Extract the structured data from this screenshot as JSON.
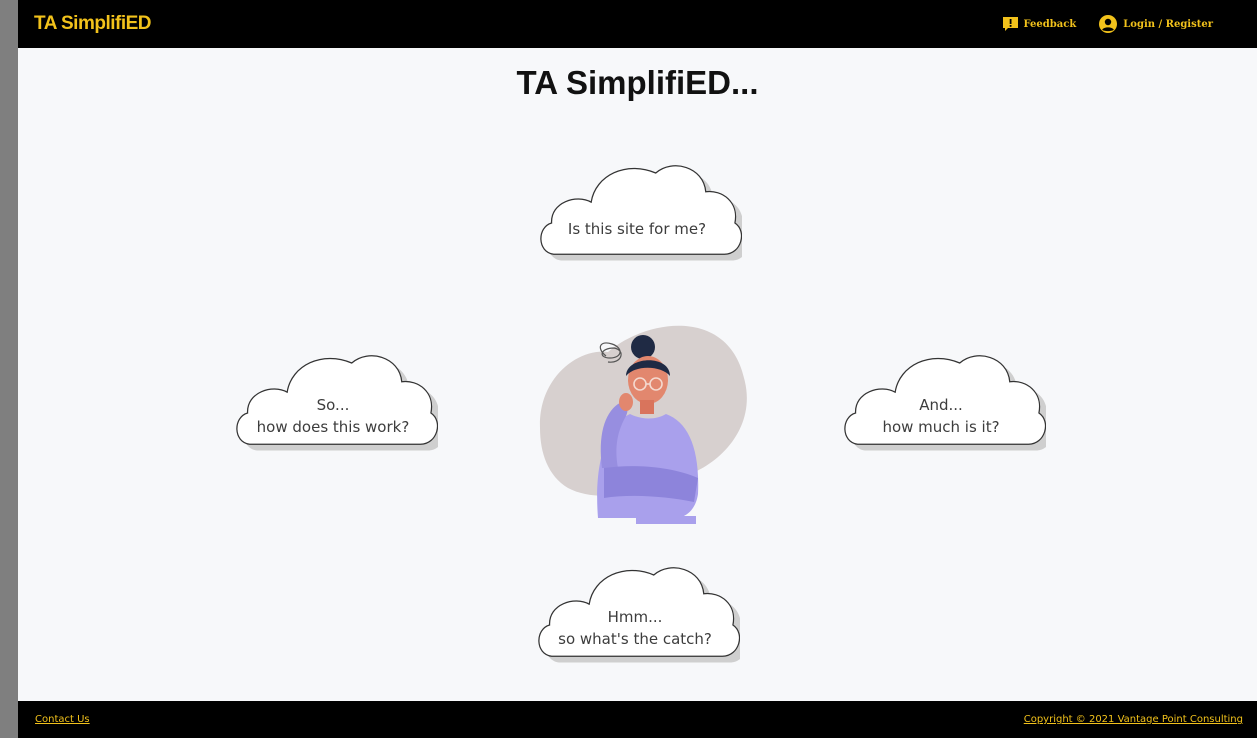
{
  "header": {
    "brand": "TA SimplifiED",
    "feedback_label": "Feedback",
    "login_label": "Login / Register"
  },
  "main": {
    "title": "TA SimplifiED...",
    "clouds": {
      "top": {
        "line1": "Is this site for me?"
      },
      "left": {
        "line1": "So...",
        "line2": "how does this work?"
      },
      "right": {
        "line1": "And...",
        "line2": "how much is it?"
      },
      "bottom": {
        "line1": "Hmm...",
        "line2": "so what's the catch?"
      }
    }
  },
  "footer": {
    "contact_label": "Contact Us",
    "copyright": "Copyright © 2021 Vantage Point Consulting"
  },
  "colors": {
    "accent": "#f2c21b",
    "bar": "#000000",
    "background": "#f7f8fa"
  },
  "icons": [
    "feedback-icon",
    "user-circle-icon",
    "cloud-icon",
    "thinking-woman-illustration"
  ]
}
